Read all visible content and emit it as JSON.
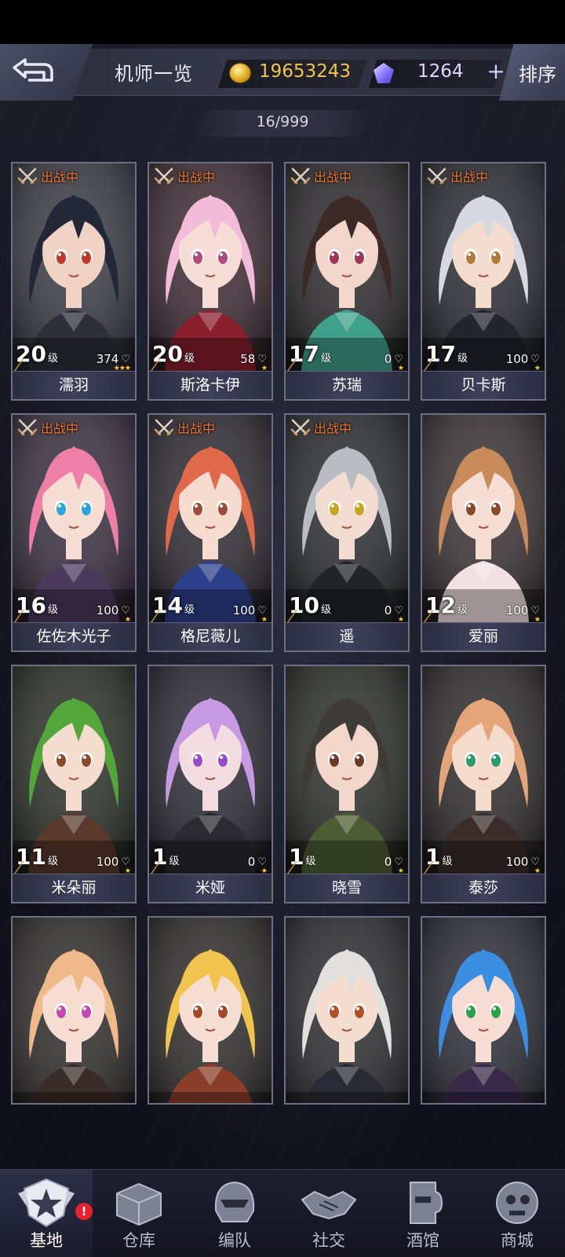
{
  "header": {
    "title": "机师一览",
    "coins": "19653243",
    "gems": "1264",
    "plus_label": "+",
    "sort_label": "排序",
    "count": "16/999"
  },
  "colors": {
    "deploy_tag": "#f07a3a",
    "coin": "#f4c44a",
    "gem": "#e2d6ff",
    "star": "#ffcc2a"
  },
  "pilots": [
    {
      "name": "濡羽",
      "level": "20",
      "level_unit": "级",
      "affinity": "374",
      "stars": "★★★",
      "deployed": true,
      "hair": "#232838",
      "skin": "#f1d3c6",
      "eye": "#c0392b",
      "outfit": "#2d2f3a",
      "bg": "#3a3b45"
    },
    {
      "name": "斯洛卡伊",
      "level": "20",
      "level_unit": "级",
      "affinity": "58",
      "stars": "★",
      "deployed": true,
      "hair": "#f2bcd8",
      "skin": "#f6ddd6",
      "eye": "#b04a7a",
      "outfit": "#8a1f2e",
      "bg": "#3e2c34"
    },
    {
      "name": "苏瑞",
      "level": "17",
      "level_unit": "级",
      "affinity": "0",
      "stars": "★",
      "deployed": true,
      "hair": "#3d2a26",
      "skin": "#f3d6cb",
      "eye": "#a1385a",
      "outfit": "#3fa08b",
      "bg": "#2c2a2c"
    },
    {
      "name": "贝卡斯",
      "level": "17",
      "level_unit": "级",
      "affinity": "100",
      "stars": "★",
      "deployed": true,
      "hair": "#d6d8e2",
      "skin": "#f3dccd",
      "eye": "#b07a3a",
      "outfit": "#23242c",
      "bg": "#2a2c34"
    },
    {
      "name": "佐佐木光子",
      "level": "16",
      "level_unit": "级",
      "affinity": "100",
      "stars": "★",
      "deployed": true,
      "hair": "#ee7fa6",
      "skin": "#f6ddd3",
      "eye": "#2aa5d9",
      "outfit": "#4a3a5c",
      "bg": "#3a2f3f"
    },
    {
      "name": "格尼薇儿",
      "level": "14",
      "level_unit": "级",
      "affinity": "100",
      "stars": "★",
      "deployed": true,
      "hair": "#e06a4a",
      "skin": "#f6dbcf",
      "eye": "#9c4e3a",
      "outfit": "#2c3f8a",
      "bg": "#2e2b33"
    },
    {
      "name": "遥",
      "level": "10",
      "level_unit": "级",
      "affinity": "0",
      "stars": "★",
      "deployed": true,
      "hair": "#b9bcc2",
      "skin": "#f2dcd2",
      "eye": "#c7a41c",
      "outfit": "#222428",
      "bg": "#2b2c30"
    },
    {
      "name": "爱丽",
      "level": "12",
      "level_unit": "级",
      "affinity": "100",
      "stars": "★",
      "deployed": false,
      "hair": "#c98b5c",
      "skin": "#f6ded4",
      "eye": "#8a4a2a",
      "outfit": "#f2e1e4",
      "bg": "#3a3234"
    },
    {
      "name": "米朵丽",
      "level": "11",
      "level_unit": "级",
      "affinity": "100",
      "stars": "★",
      "deployed": false,
      "hair": "#52a63a",
      "skin": "#f4dccf",
      "eye": "#8a4a2a",
      "outfit": "#5a3a2c",
      "bg": "#2c3128"
    },
    {
      "name": "米娅",
      "level": "1",
      "level_unit": "级",
      "affinity": "0",
      "stars": "★",
      "deployed": false,
      "hair": "#c69ae2",
      "skin": "#f3dde0",
      "eye": "#9a4ac9",
      "outfit": "#2a2a30",
      "bg": "#2c2a34"
    },
    {
      "name": "晓雪",
      "level": "1",
      "level_unit": "级",
      "affinity": "0",
      "stars": "★",
      "deployed": false,
      "hair": "#3e3a36",
      "skin": "#f1d6c9",
      "eye": "#6a3a2a",
      "outfit": "#4e5c34",
      "bg": "#2c2e28"
    },
    {
      "name": "泰莎",
      "level": "1",
      "level_unit": "级",
      "affinity": "100",
      "stars": "★",
      "deployed": false,
      "hair": "#e5a57a",
      "skin": "#f4dbcc",
      "eye": "#2a9a6a",
      "outfit": "#3a2d2a",
      "bg": "#2e2b2c"
    }
  ],
  "partial_pilots": [
    {
      "hair": "#f0b98a",
      "skin": "#f6dcd1",
      "eye": "#c04ab0",
      "outfit": "#3a2c28",
      "bg": "#302c2c"
    },
    {
      "hair": "#f1c44e",
      "skin": "#f6ddd2",
      "eye": "#a04a2a",
      "outfit": "#8a3e2a",
      "bg": "#2f2c2a"
    },
    {
      "hair": "#e2e0dc",
      "skin": "#f4dccf",
      "eye": "#b0502a",
      "outfit": "#2a2a34",
      "bg": "#2c2c30"
    },
    {
      "hair": "#3c8fe0",
      "skin": "#f6dcd3",
      "eye": "#2aa04a",
      "outfit": "#3a2a4a",
      "bg": "#2a2c36"
    }
  ],
  "deploy_label": "出战中",
  "nav": [
    {
      "label": "基地",
      "icon": "base-emblem-icon",
      "active": true,
      "alert": "!"
    },
    {
      "label": "仓库",
      "icon": "warehouse-crate-icon",
      "active": false
    },
    {
      "label": "编队",
      "icon": "formation-helmet-icon",
      "active": false
    },
    {
      "label": "社交",
      "icon": "handshake-icon",
      "active": false
    },
    {
      "label": "酒馆",
      "icon": "tavern-icon",
      "active": false
    },
    {
      "label": "商城",
      "icon": "shop-robot-icon",
      "active": false
    }
  ]
}
